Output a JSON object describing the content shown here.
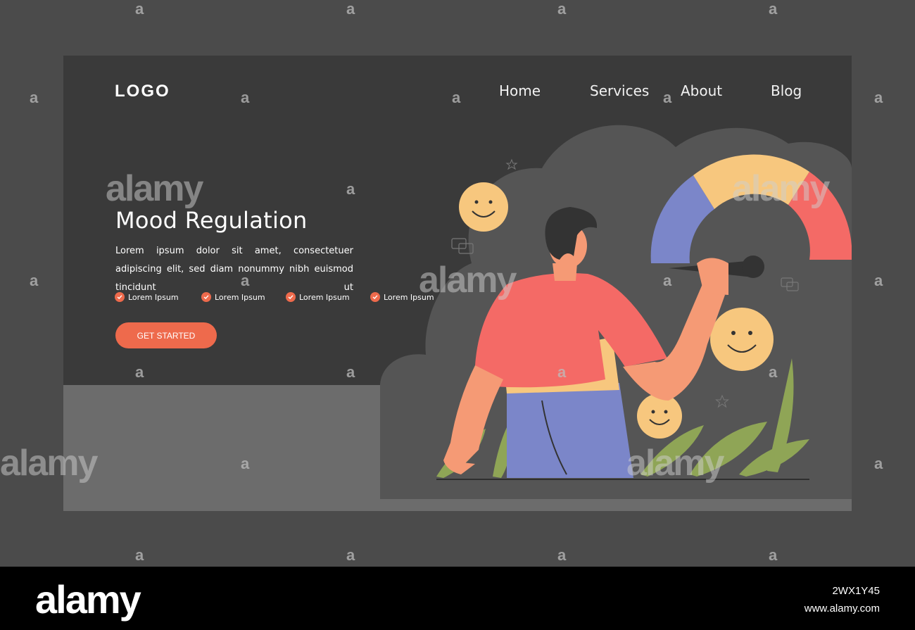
{
  "header": {
    "logo": "LOGO",
    "nav": [
      {
        "label": "Home"
      },
      {
        "label": "Services"
      },
      {
        "label": "About"
      },
      {
        "label": "Blog"
      }
    ]
  },
  "hero": {
    "title": "Mood Regulation",
    "description": "Lorem ipsum dolor sit amet, consectetuer adipiscing elit, sed diam nonummy nibh euismod tincidunt ut",
    "features": [
      "Lorem Ipsum",
      "Lorem Ipsum",
      "Lorem Ipsum",
      "Lorem Ipsum"
    ],
    "cta_label": "GET STARTED"
  },
  "watermark": {
    "brand": "alamy",
    "glyph": "a",
    "image_id": "2WX1Y45",
    "site": "www.alamy.com"
  },
  "colors": {
    "background": "#4b4b4b",
    "card_dark": "#3a3a3a",
    "card_light": "#6c6c6c",
    "accent": "#ee6a4c",
    "gauge_blue": "#7b86c9",
    "gauge_yellow": "#f7c77e",
    "gauge_red": "#f46a66",
    "smiley": "#f7c77e"
  },
  "icons": [
    "check-icon",
    "smiley-icon",
    "star-icon",
    "chat-bubble-icon",
    "leaf-icon",
    "gauge-needle-icon"
  ]
}
